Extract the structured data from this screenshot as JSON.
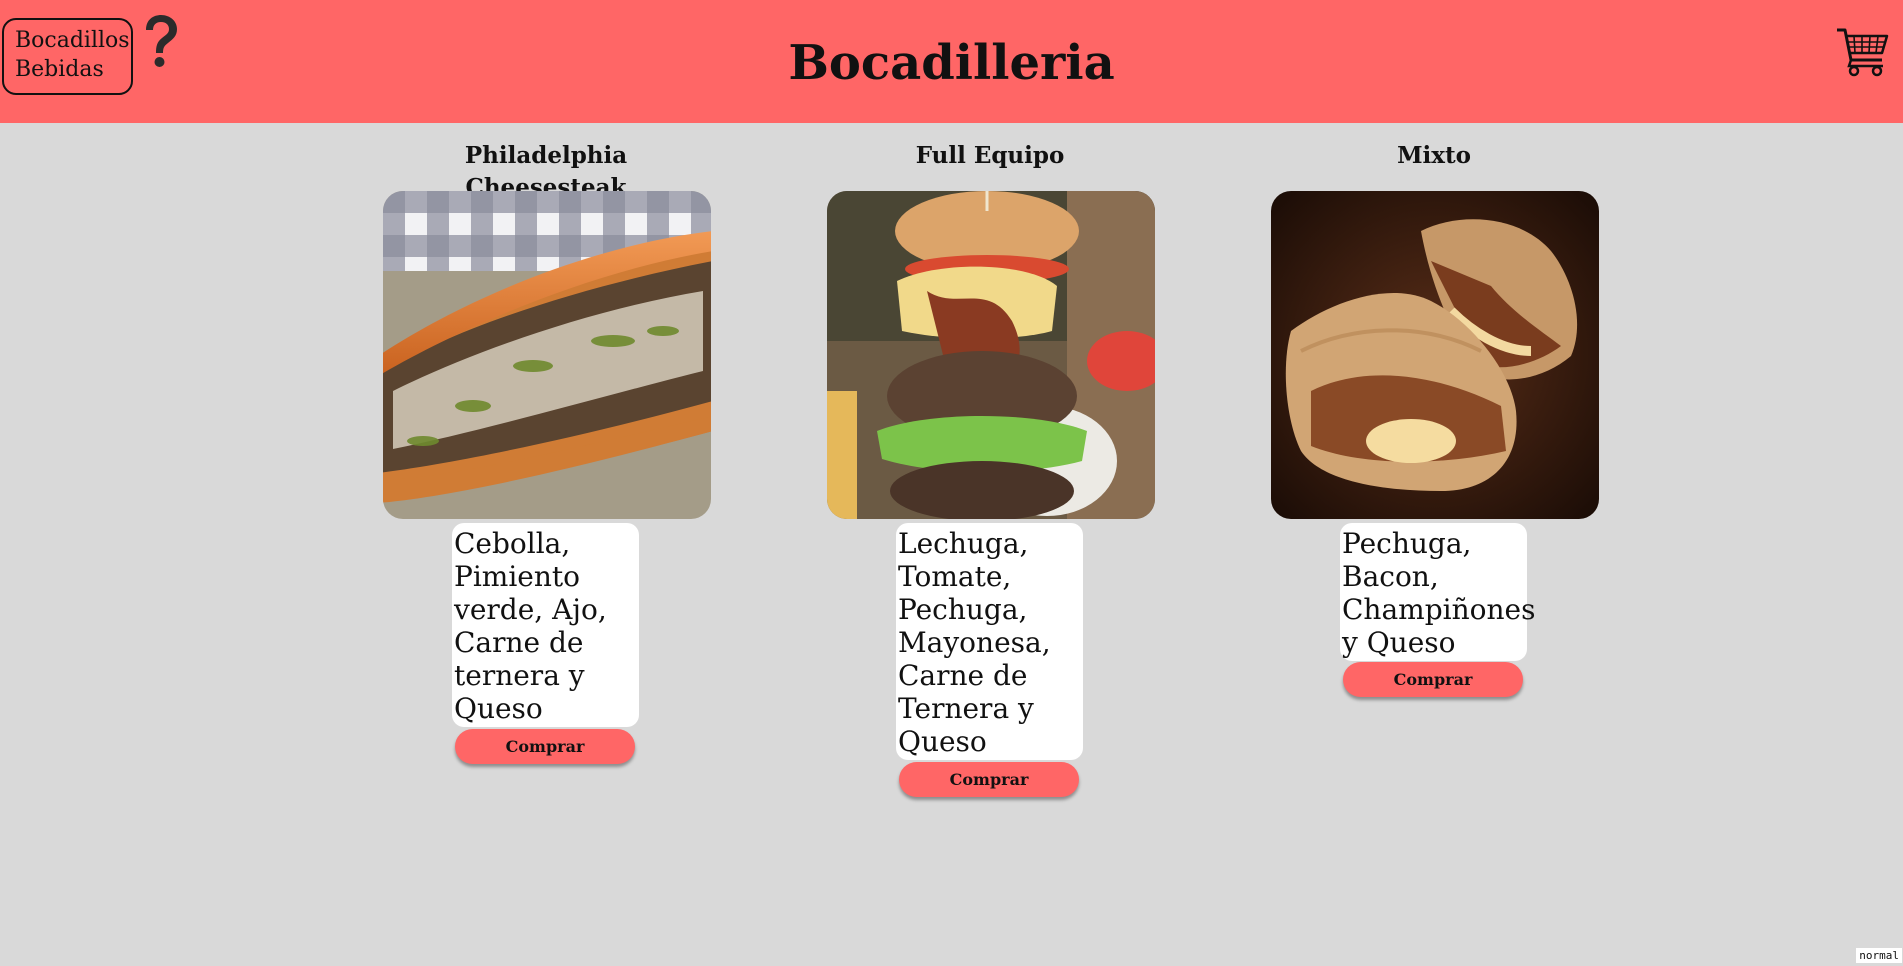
{
  "nav": {
    "links": [
      "Bocadillos",
      "Bebidas"
    ]
  },
  "header": {
    "title": "Bocadilleria",
    "help_icon": "question-mark-icon",
    "cart_icon": "shopping-cart-icon"
  },
  "products": [
    {
      "name": "Philadelphia Cheesesteak",
      "ingredients": "Cebolla,\nPimiento\nverde, Ajo,\nCarne de\nternera y\nQueso",
      "buy_label": "Comprar"
    },
    {
      "name": "Full Equipo",
      "ingredients": "Lechuga,\nTomate,\nPechuga,\nMayonesa,\nCarne de\nTernera y\nQueso",
      "buy_label": "Comprar"
    },
    {
      "name": "Mixto",
      "ingredients": "Pechuga,\nBacon,\nChampiñones\ny Queso",
      "buy_label": "Comprar"
    }
  ],
  "status": "normal",
  "colors": {
    "header": "#ff6666",
    "background": "#d9d9d9",
    "button": "#ff6666"
  }
}
